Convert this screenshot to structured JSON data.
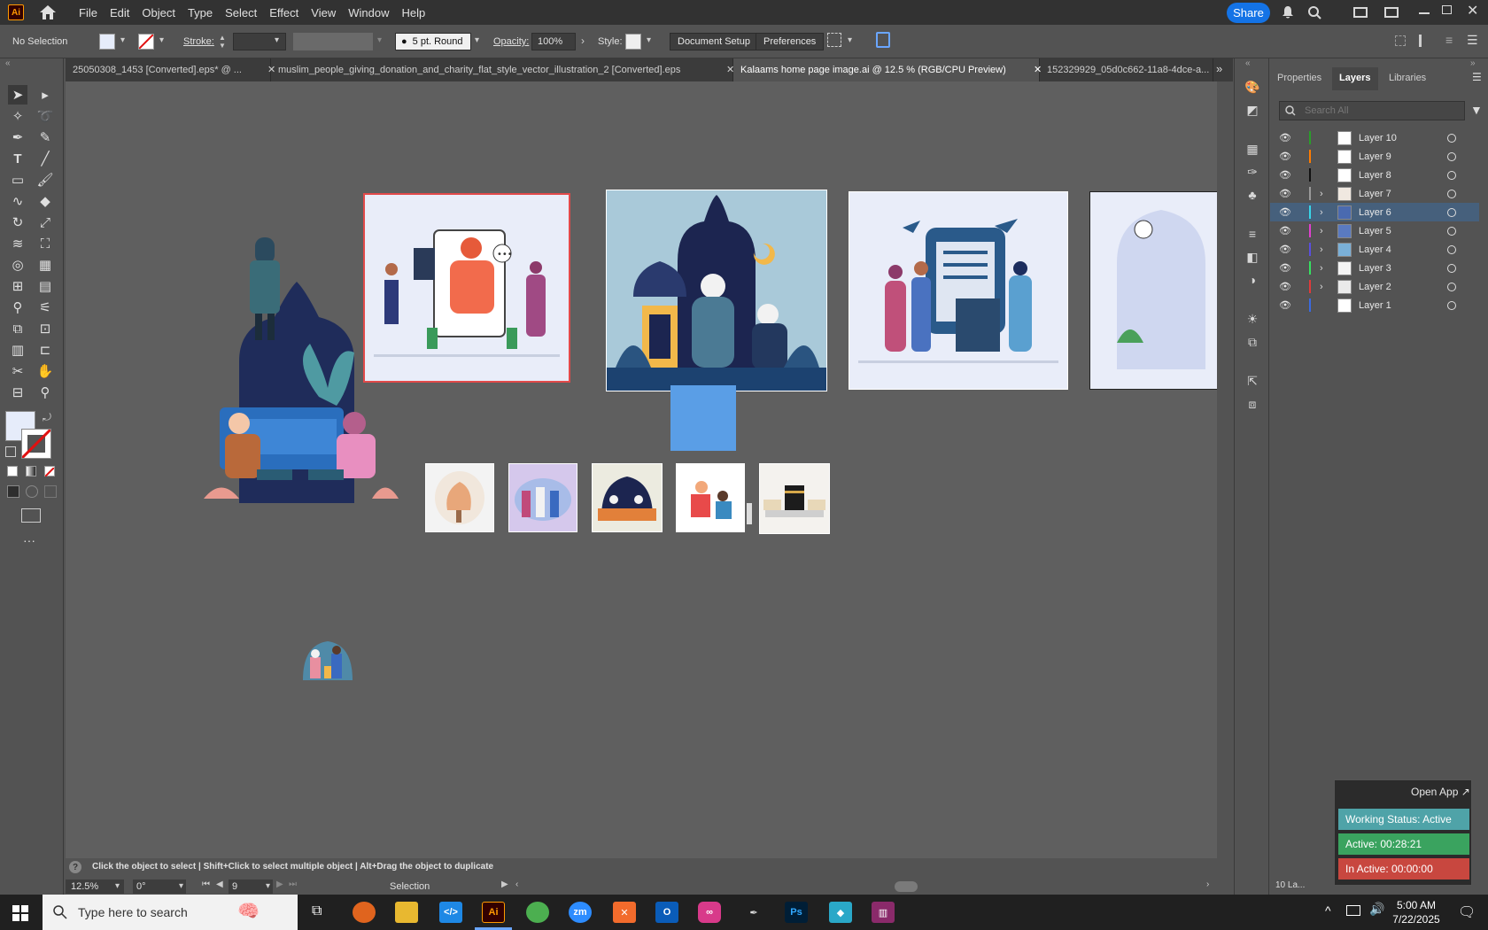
{
  "menubar": {
    "app_badge": "Ai",
    "items": [
      "File",
      "Edit",
      "Object",
      "Type",
      "Select",
      "Effect",
      "View",
      "Window",
      "Help"
    ],
    "share_label": "Share"
  },
  "control_bar": {
    "selection": "No Selection",
    "stroke_label": "Stroke:",
    "brush": "5 pt. Round",
    "opacity_label": "Opacity:",
    "opacity_value": "100%",
    "style_label": "Style:",
    "document_setup": "Document Setup",
    "preferences": "Preferences"
  },
  "tabs": [
    {
      "label": "25050308_1453 [Converted].eps* @ ...",
      "active": false
    },
    {
      "label": "muslim_people_giving_donation_and_charity_flat_style_vector_illustration_2 [Converted].eps",
      "active": false
    },
    {
      "label": "Kalaams home page image.ai @ 12.5 % (RGB/CPU Preview)",
      "active": true
    },
    {
      "label": "152329929_05d0c662-11a8-4dce-a...",
      "active": false
    }
  ],
  "panels": {
    "tabs": [
      "Properties",
      "Layers",
      "Libraries"
    ],
    "active_tab": "Layers",
    "search_placeholder": "Search All",
    "layers": [
      {
        "name": "Layer 10",
        "color": "#2a9d2a",
        "expandable": false,
        "selected": false
      },
      {
        "name": "Layer 9",
        "color": "#ff7b00",
        "expandable": false,
        "selected": false
      },
      {
        "name": "Layer 8",
        "color": "#111111",
        "expandable": false,
        "selected": false
      },
      {
        "name": "Layer 7",
        "color": "#9a9a9a",
        "expandable": true,
        "selected": false
      },
      {
        "name": "Layer 6",
        "color": "#38d6e8",
        "expandable": true,
        "selected": true
      },
      {
        "name": "Layer 5",
        "color": "#e040d0",
        "expandable": true,
        "selected": false
      },
      {
        "name": "Layer 4",
        "color": "#5a4fe0",
        "expandable": true,
        "selected": false
      },
      {
        "name": "Layer 3",
        "color": "#36e060",
        "expandable": true,
        "selected": false
      },
      {
        "name": "Layer 2",
        "color": "#e03a3a",
        "expandable": true,
        "selected": false
      },
      {
        "name": "Layer 1",
        "color": "#3a6ae0",
        "expandable": false,
        "selected": false
      }
    ],
    "layer_count": "10 La..."
  },
  "status": {
    "hint": "Click the object to select  |  Shift+Click to select multiple object  |  Alt+Drag the object to duplicate",
    "zoom": "12.5%",
    "rotation": "0°",
    "artboard_number": "9",
    "tool_name": "Selection"
  },
  "widget": {
    "open_app": "Open App",
    "working_status": "Working Status: Active",
    "active_time": "Active: 00:28:21",
    "inactive_time": "In Active: 00:00:00"
  },
  "taskbar": {
    "search_placeholder": "Type here to search",
    "time": "5:00 AM",
    "date": "7/22/2025"
  },
  "colors": {
    "accent": "#1473e6",
    "status_active": "#3aa35f",
    "status_inactive": "#c8473f",
    "status_working": "#4fa3a8"
  }
}
